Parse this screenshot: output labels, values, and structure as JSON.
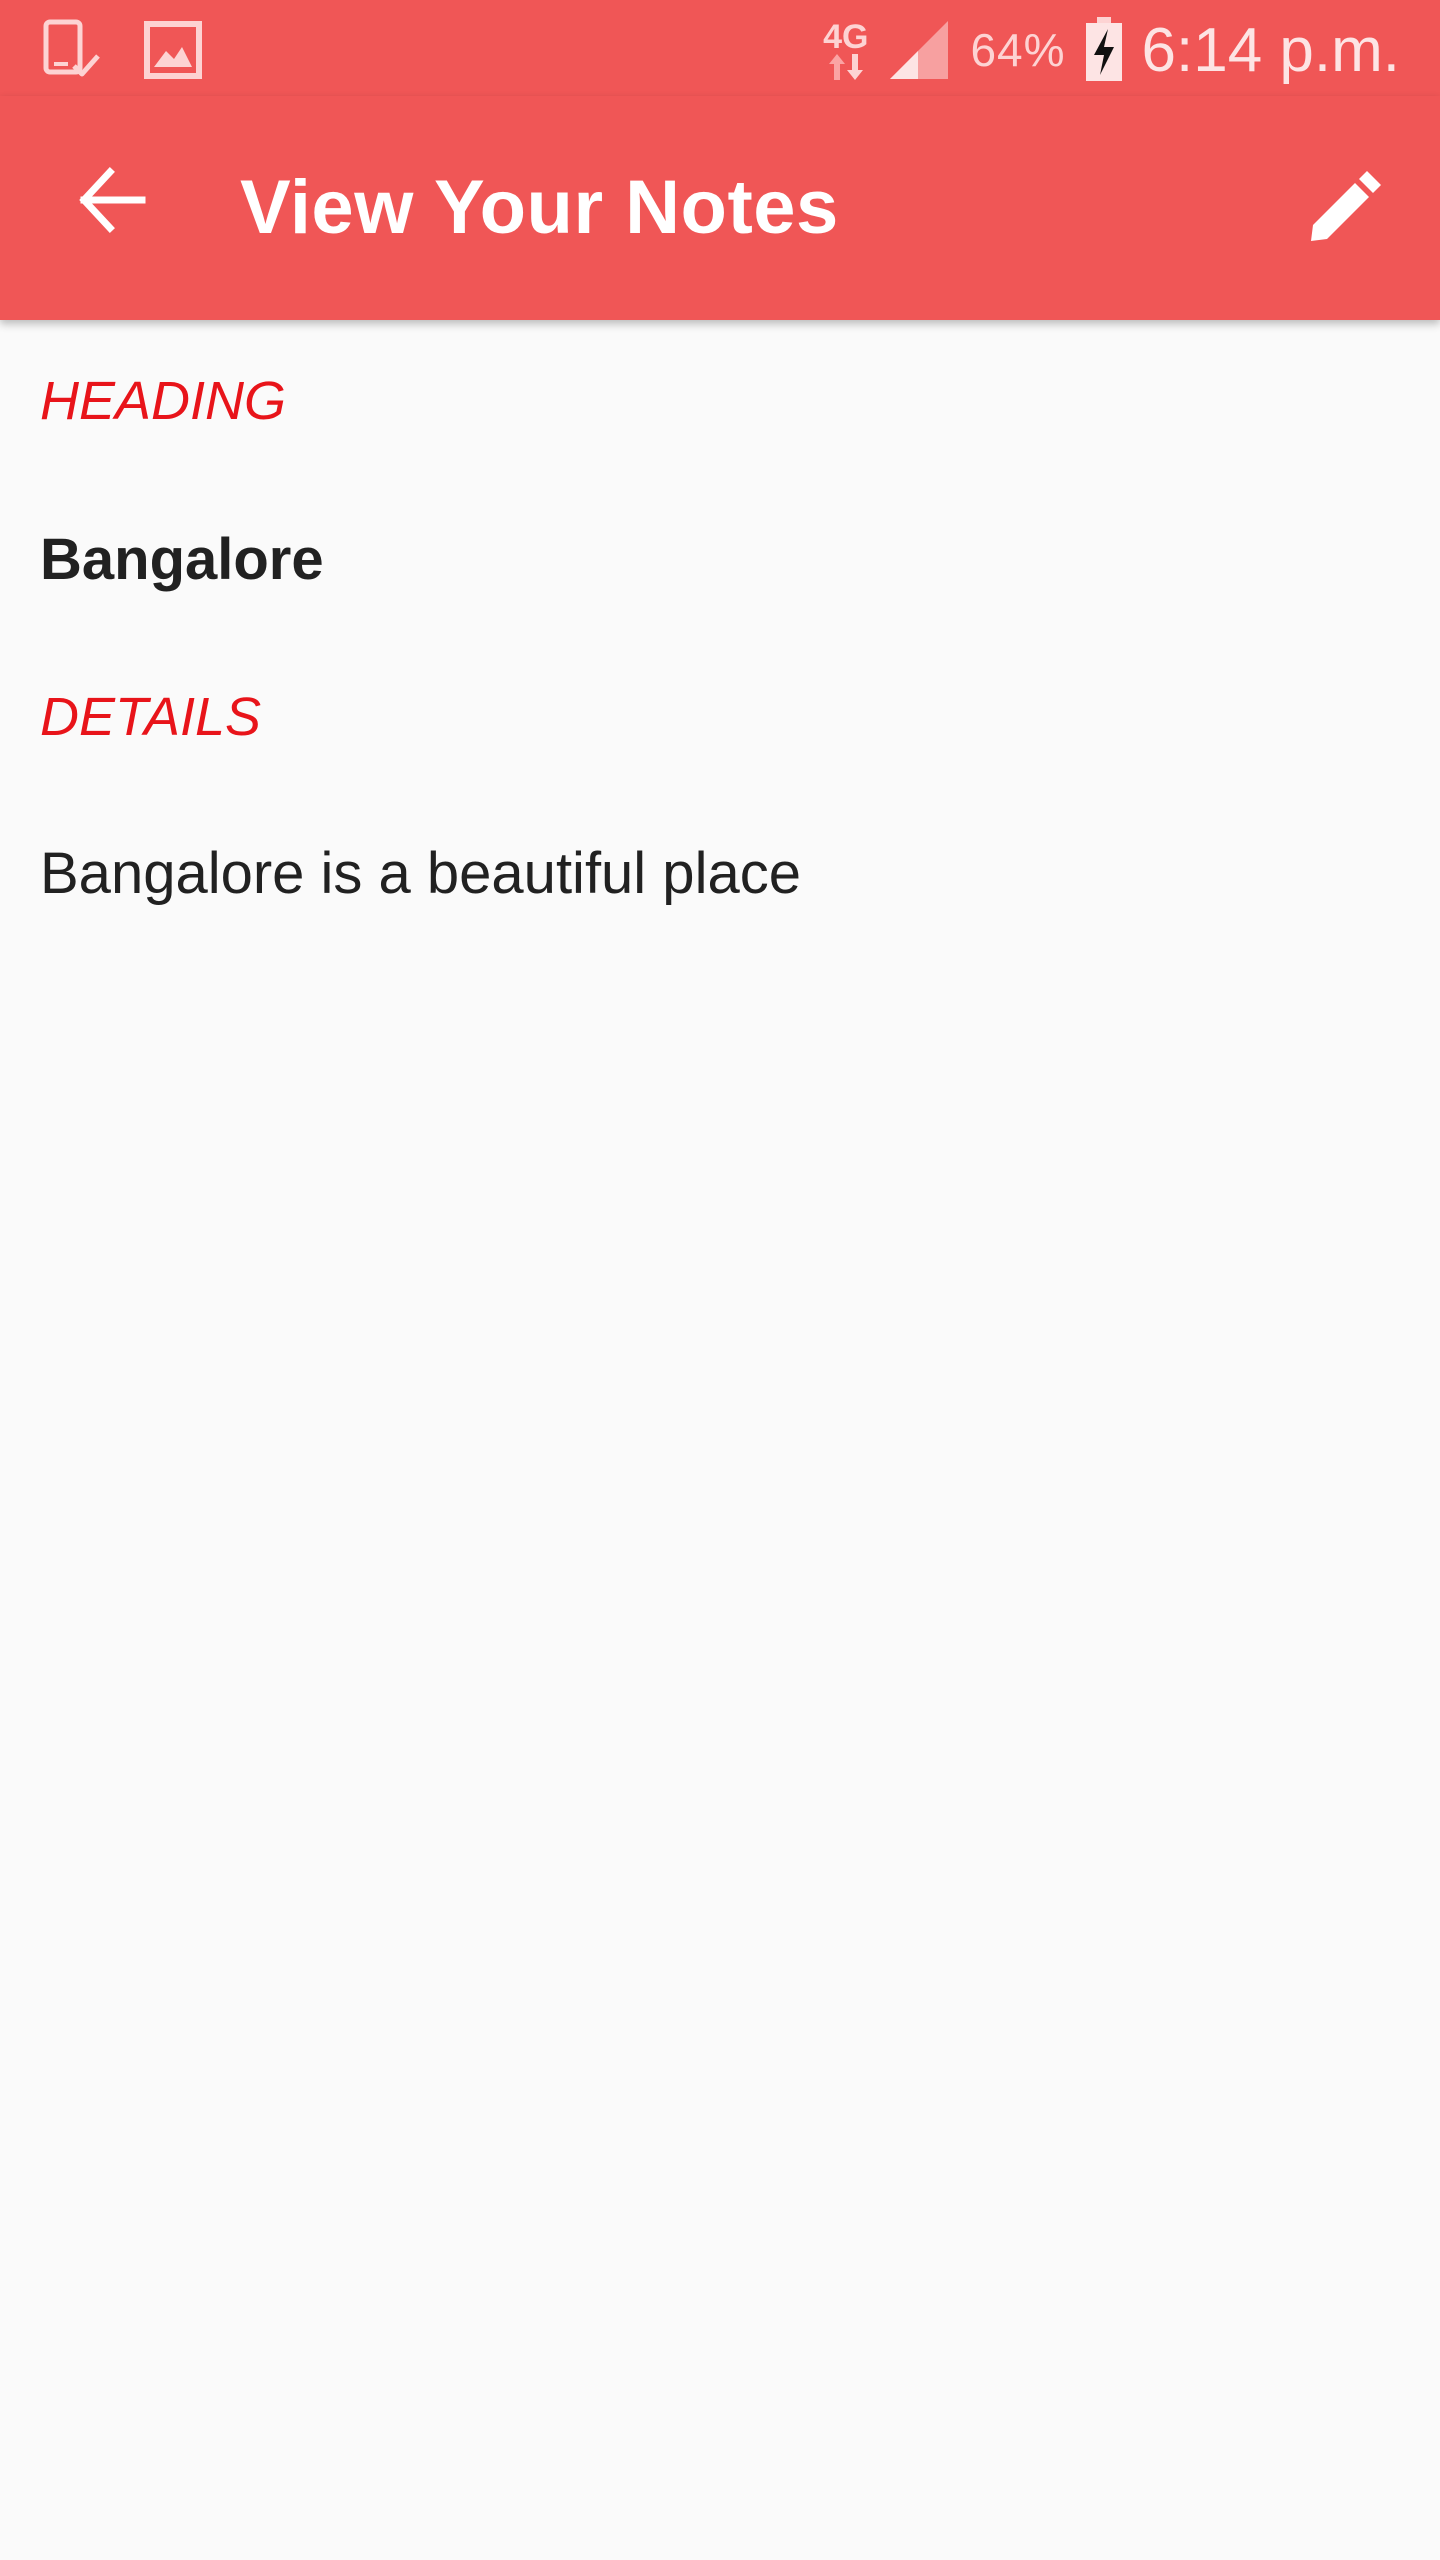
{
  "status_bar": {
    "network_type": "4G",
    "battery_percent": "64%",
    "time": "6:14 p.m."
  },
  "app_bar": {
    "title": "View Your Notes",
    "back_icon": "arrow-back-icon",
    "edit_icon": "pencil-icon"
  },
  "note": {
    "heading_label": "HEADING",
    "heading_value": "Bangalore",
    "details_label": "DETAILS",
    "details_value": "Bangalore is a beautiful place"
  },
  "colors": {
    "primary": "#f05656",
    "accent": "#e8141a",
    "text": "#212121",
    "background": "#fafafa"
  }
}
